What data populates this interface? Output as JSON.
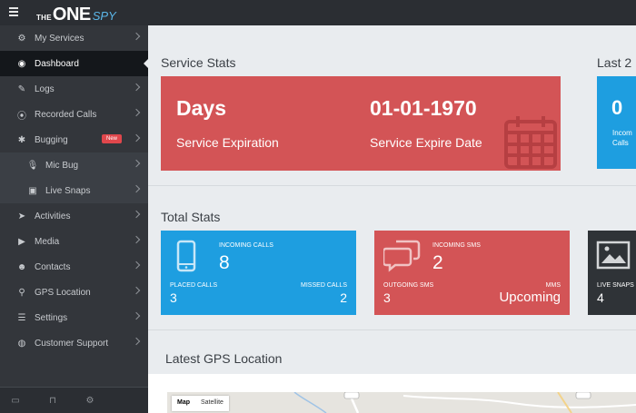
{
  "brand": {
    "the": "THE",
    "one": "ONE",
    "spy": "SPY"
  },
  "sidebar": {
    "items": [
      {
        "label": "My Services",
        "icon": "gears-icon"
      },
      {
        "label": "Dashboard",
        "icon": "dashboard-icon"
      },
      {
        "label": "Logs",
        "icon": "edit-icon"
      },
      {
        "label": "Recorded Calls",
        "icon": "record-icon"
      },
      {
        "label": "Bugging",
        "icon": "bug-icon",
        "badge": "New"
      },
      {
        "label": "Mic Bug",
        "icon": "microphone-icon"
      },
      {
        "label": "Live Snaps",
        "icon": "camera-icon"
      },
      {
        "label": "Activities",
        "icon": "paper-plane-icon"
      },
      {
        "label": "Media",
        "icon": "play-icon"
      },
      {
        "label": "Contacts",
        "icon": "users-icon"
      },
      {
        "label": "GPS Location",
        "icon": "map-pin-icon"
      },
      {
        "label": "Settings",
        "icon": "sliders-icon"
      },
      {
        "label": "Customer Support",
        "icon": "globe-icon"
      }
    ]
  },
  "service_stats": {
    "title": "Service Stats",
    "days_value": "Days",
    "days_label": "Service Expiration",
    "date_value": "01-01-1970",
    "date_label": "Service Expire Date",
    "last_title": "Last 2",
    "last_value": "0",
    "last_label_1": "Incom",
    "last_label_2": "Calls"
  },
  "total_stats": {
    "title": "Total Stats",
    "calls": {
      "incoming_label": "INCOMING CALLS",
      "incoming_value": "8",
      "placed_label": "PLACED CALLS",
      "placed_value": "3",
      "missed_label": "MISSED CALLS",
      "missed_value": "2"
    },
    "sms": {
      "incoming_label": "INCOMING SMS",
      "incoming_value": "2",
      "outgoing_label": "OUTGOING SMS",
      "outgoing_value": "3",
      "mms_label": "MMS",
      "mms_value": "Upcoming"
    },
    "snaps": {
      "label": "LIVE SNAPS",
      "value": "4"
    }
  },
  "gps": {
    "title": "Latest GPS Location",
    "map_label": "Map",
    "satellite_label": "Satellite"
  },
  "colors": {
    "red": "#d35456",
    "blue": "#1e9ee0",
    "sidebar": "#33363b",
    "active": "#14171b"
  }
}
